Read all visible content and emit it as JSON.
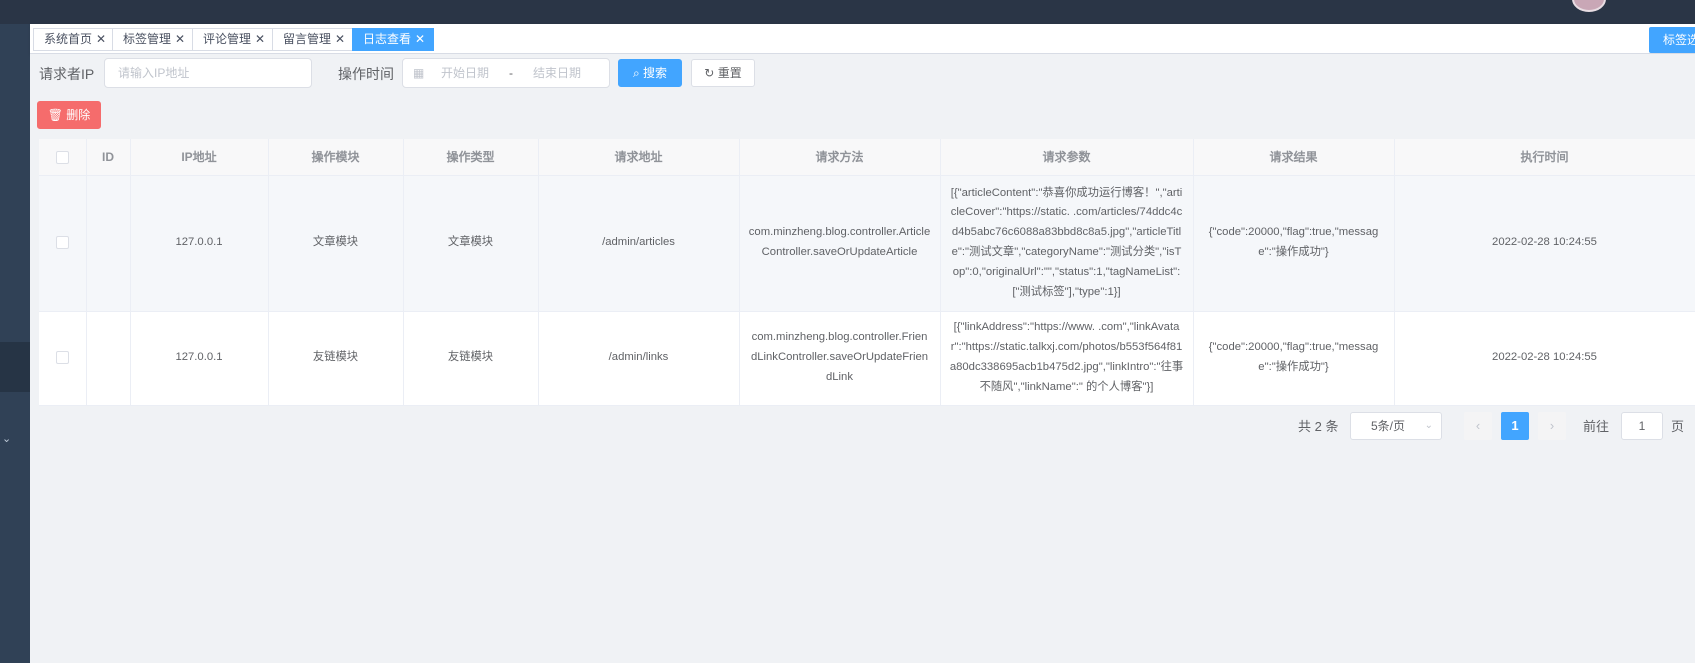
{
  "tabs": [
    {
      "label": "系统首页",
      "active": false
    },
    {
      "label": "标签管理",
      "active": false
    },
    {
      "label": "评论管理",
      "active": false
    },
    {
      "label": "留言管理",
      "active": false
    },
    {
      "label": "日志查看",
      "active": true
    }
  ],
  "tag_options_label": "标签选项",
  "filters": {
    "ip_label": "请求者IP",
    "ip_placeholder": "请输入IP地址",
    "time_label": "操作时间",
    "start_placeholder": "开始日期",
    "range_separator": "-",
    "end_placeholder": "结束日期",
    "search_label": "搜索",
    "reset_label": "重置"
  },
  "delete_label": "删除",
  "table": {
    "columns": [
      "ID",
      "IP地址",
      "操作模块",
      "操作类型",
      "请求地址",
      "请求方法",
      "请求参数",
      "请求结果",
      "执行时间"
    ],
    "rows": [
      {
        "id": "",
        "ip": "127.0.0.1",
        "module": "文章模块",
        "type": "文章模块",
        "url": "/admin/articles",
        "method": "com.minzheng.blog.controller.ArticleController.saveOrUpdateArticle",
        "params": "[{\"articleContent\":\"恭喜你成功运行博客！\",\"articleCover\":\"https://static.          .com/articles/74ddc4cd4b5abc76c6088a83bbd8c8a5.jpg\",\"articleTitle\":\"测试文章\",\"categoryName\":\"测试分类\",\"isTop\":0,\"originalUrl\":\"\",\"status\":1,\"tagNameList\":[\"测试标签\"],\"type\":1}]",
        "result": "{\"code\":20000,\"flag\":true,\"message\":\"操作成功\"}",
        "time": "2022-02-28 10:24:55"
      },
      {
        "id": "",
        "ip": "127.0.0.1",
        "module": "友链模块",
        "type": "友链模块",
        "url": "/admin/links",
        "method": "com.minzheng.blog.controller.FriendLinkController.saveOrUpdateFriendLink",
        "params": "[{\"linkAddress\":\"https://www.         .com\",\"linkAvatar\":\"https://static.talkxj.com/photos/b553f564f81a80dc338695acb1b475d2.jpg\",\"linkIntro\":\"往事不随风\",\"linkName\":\"        的个人博客\"}]",
        "result": "{\"code\":20000,\"flag\":true,\"message\":\"操作成功\"}",
        "time": "2022-02-28 10:24:55"
      }
    ]
  },
  "pagination": {
    "total_text": "共 2 条",
    "page_size": "5条/页",
    "prev": "‹",
    "current_page": "1",
    "next": "›",
    "goto_label": "前往",
    "goto_value": "1",
    "page_suffix": "页"
  },
  "colors": {
    "primary": "#42a5ff",
    "danger": "#f56c6c",
    "sidebar": "#304156",
    "topbar": "#2a3546"
  }
}
